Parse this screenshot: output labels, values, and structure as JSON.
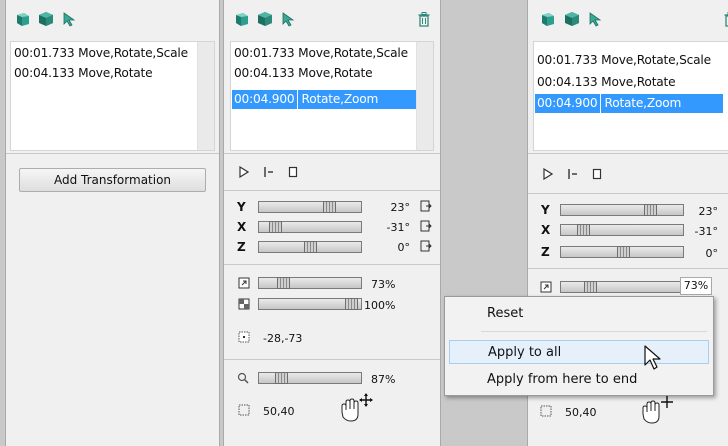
{
  "panel1": {
    "rows": [
      {
        "time": "00:01.733",
        "ops": "Move,Rotate,Scale"
      },
      {
        "time": "00:04.133",
        "ops": "Move,Rotate"
      }
    ],
    "add_button": "Add Transformation"
  },
  "panel2": {
    "rows": [
      {
        "time": "00:01.733",
        "ops": "Move,Rotate,Scale"
      },
      {
        "time": "00:04.133",
        "ops": "Move,Rotate"
      },
      {
        "time": "00:04.900",
        "ops": "Rotate,Zoom"
      }
    ],
    "axes": [
      {
        "label": "Y",
        "value": "23°",
        "level": 0.72
      },
      {
        "label": "X",
        "value": "-31°",
        "level": 0.11
      },
      {
        "label": "Z",
        "value": "0°",
        "level": 0.5
      }
    ],
    "scale": {
      "value": "73%",
      "level": 0.2
    },
    "opacity": {
      "value": "100%",
      "level": 0.97
    },
    "move": "-28,-73",
    "zoom": {
      "value": "87%",
      "level": 0.18
    },
    "size": "50,40"
  },
  "panel3": {
    "rows": [
      {
        "time": "00:01.733",
        "ops": "Move,Rotate,Scale"
      },
      {
        "time": "00:04.133",
        "ops": "Move,Rotate"
      },
      {
        "time": "00:04.900",
        "ops": "Rotate,Zoom"
      }
    ],
    "axes": [
      {
        "label": "Y",
        "value": "23°"
      },
      {
        "label": "X",
        "value": "-31°"
      },
      {
        "label": "Z",
        "value": "0°"
      }
    ],
    "scale_value": "73%",
    "size": "50,40"
  },
  "context_menu": {
    "items": [
      "Reset",
      "Apply to all",
      "Apply from here to end"
    ],
    "highlighted": "Apply to all"
  },
  "colors": {
    "selection": "#3399ff",
    "menu_highlight": "#e5f0fb"
  }
}
